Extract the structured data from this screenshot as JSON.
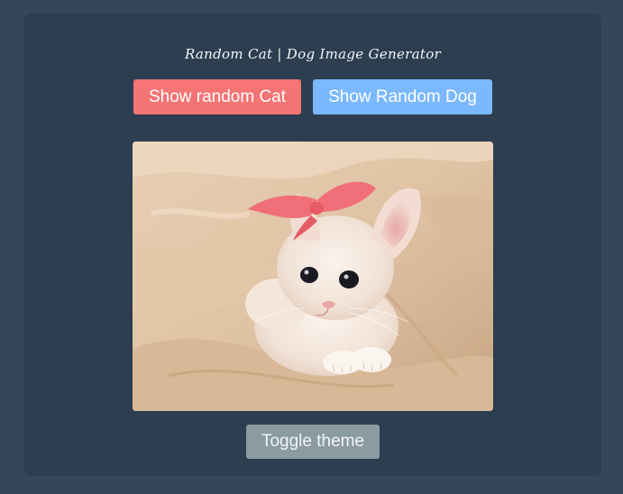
{
  "header": {
    "title": "Random Cat | Dog Image Generator"
  },
  "buttons": {
    "cat_label": "Show random Cat",
    "dog_label": "Show Random Dog",
    "theme_label": "Toggle theme"
  },
  "image": {
    "subject": "white kitten with pink bow on blanket"
  },
  "colors": {
    "page_background": "#34465a",
    "card_background": "#2c3e50",
    "cat_button": "#f57474",
    "dog_button": "#7ab8ff",
    "theme_button": "#8a9ba1"
  }
}
